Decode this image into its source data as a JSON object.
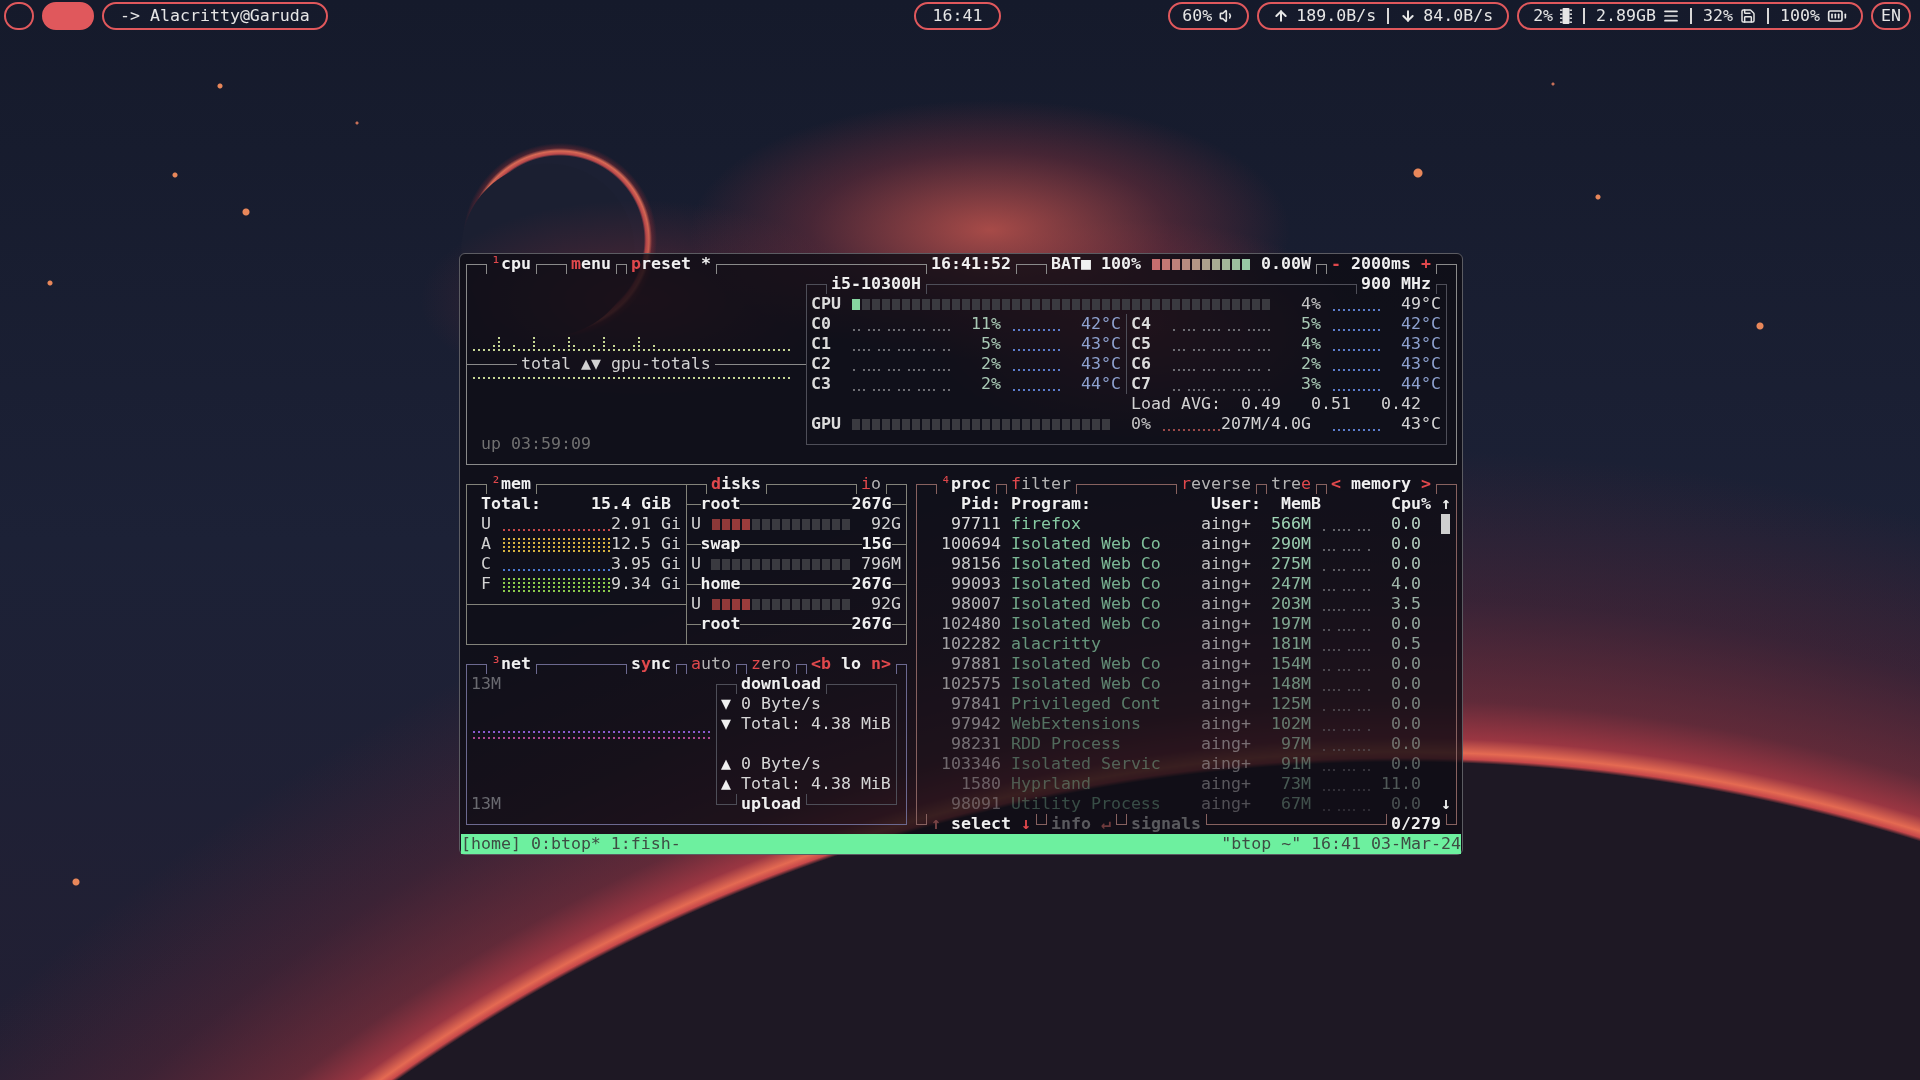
{
  "top_bar": {
    "workspaces": [
      {
        "selected": false
      },
      {
        "selected": true
      }
    ],
    "window_title": "-> Alacritty@Garuda",
    "clock": "16:41",
    "volume": "60%",
    "network": {
      "upload": "189.0B/s",
      "download": "84.0B/s"
    },
    "system": {
      "cpu": "2%",
      "memory": "2.89GB",
      "disk": "32%",
      "battery": "100%"
    },
    "keyboard_layout": "EN"
  },
  "cpu": {
    "number": "¹",
    "title": "cpu",
    "menu": {
      "key": "m",
      "after": "enu"
    },
    "preset": {
      "key": "p",
      "after": "reset *"
    },
    "clock": "16:41:52",
    "battery": {
      "label": "BAT■",
      "percent": "100%",
      "level": 1,
      "power": "0.00W"
    },
    "interval": {
      "decrease": "-",
      "value": "2000ms",
      "increase": "+"
    },
    "graph_label": "total ▲▼ gpu-totals",
    "uptime": "up 03:59:09",
    "model": "i5-10300H",
    "frequency": "900 MHz",
    "total": {
      "label": "CPU",
      "level": 0.03,
      "percent": "4%",
      "temperature": "49°C"
    },
    "cores": [
      {
        "label": "C0",
        "percent": "11%",
        "temperature": "42°C"
      },
      {
        "label": "C1",
        "percent": "5%",
        "temperature": "43°C"
      },
      {
        "label": "C2",
        "percent": "2%",
        "temperature": "43°C"
      },
      {
        "label": "C3",
        "percent": "2%",
        "temperature": "44°C"
      },
      {
        "label": "C4",
        "percent": "5%",
        "temperature": "42°C"
      },
      {
        "label": "C5",
        "percent": "4%",
        "temperature": "43°C"
      },
      {
        "label": "C6",
        "percent": "2%",
        "temperature": "43°C"
      },
      {
        "label": "C7",
        "percent": "3%",
        "temperature": "44°C"
      }
    ],
    "load_avg": {
      "label": "Load AVG:",
      "values": [
        "0.49",
        "0.51",
        "0.42"
      ]
    },
    "gpu": {
      "label": "GPU",
      "level": 0,
      "percent": "0%",
      "memory": "207M/4.0G",
      "temperature": "43°C"
    }
  },
  "mem": {
    "number": "²",
    "title": "mem",
    "total": {
      "label": "Total:",
      "value": "15.4 GiB"
    },
    "stats": [
      {
        "label": "U",
        "value": "2.91 Gi",
        "color": "#c84848",
        "filled": false
      },
      {
        "label": "A",
        "value": "12.5 Gi",
        "color": "#d8b440",
        "filled": true
      },
      {
        "label": "C",
        "value": "3.95 Gi",
        "color": "#4a78d0",
        "filled": false
      },
      {
        "label": "F",
        "value": "9.34 Gi",
        "color": "#8ccc4c",
        "filled": true
      }
    ]
  },
  "disks": {
    "title": {
      "key": "d",
      "after": "isks"
    },
    "io": {
      "key": "i",
      "after": "o",
      "on": false
    },
    "items": [
      {
        "name": "root",
        "size": "267G",
        "used": {
          "label": "U",
          "level": 0.29,
          "value": "92G"
        }
      },
      {
        "name": "swap",
        "size": "15G",
        "used": {
          "label": "U",
          "level": 0,
          "value": "796M"
        }
      },
      {
        "name": "home",
        "size": "267G",
        "used": {
          "label": "U",
          "level": 0.29,
          "value": "92G"
        }
      },
      {
        "name": "root",
        "size": "267G"
      }
    ]
  },
  "net": {
    "number": "³",
    "title": "net",
    "toggles": [
      {
        "before": "s",
        "key": "y",
        "after": "nc",
        "on": true
      },
      {
        "key": "a",
        "after": "uto",
        "on": false
      },
      {
        "key": "z",
        "after": "ero",
        "on": false
      }
    ],
    "interface": {
      "previous": "<b",
      "name": "lo",
      "next": "n>"
    },
    "scale_top": "13M",
    "scale_bottom": "13M",
    "download": {
      "label": "download",
      "lines": [
        {
          "arrow": "▼",
          "text": "0 Byte/s"
        },
        {
          "arrow": "▼",
          "text": "Total: 4.38 MiB"
        }
      ]
    },
    "upload": {
      "label": "upload",
      "lines": [
        {
          "arrow": "▲",
          "text": "0 Byte/s"
        },
        {
          "arrow": "▲",
          "text": "Total: 4.38 MiB"
        }
      ]
    }
  },
  "proc": {
    "number": "⁴",
    "title": "proc",
    "filter": {
      "key": "f",
      "after": "ilter",
      "on": false
    },
    "reverse": {
      "key": "r",
      "after": "everse",
      "on": false
    },
    "tree": {
      "before": "tre",
      "key": "e",
      "on": false
    },
    "sort": {
      "previous": "<",
      "name": "memory",
      "next": ">"
    },
    "columns": [
      "Pid:",
      "Program:",
      "User:",
      "MemB",
      "Cpu%"
    ],
    "rows": [
      {
        "pid": "97711",
        "program": "firefox",
        "user": "aing+",
        "mem": "566M",
        "cpu": "0.0",
        "selected": false
      },
      {
        "pid": "100694",
        "program": "Isolated Web Co",
        "user": "aing+",
        "mem": "290M",
        "cpu": "0.0",
        "selected": false
      },
      {
        "pid": "98156",
        "program": "Isolated Web Co",
        "user": "aing+",
        "mem": "275M",
        "cpu": "0.0",
        "selected": false
      },
      {
        "pid": "99093",
        "program": "Isolated Web Co",
        "user": "aing+",
        "mem": "247M",
        "cpu": "4.0",
        "selected": false
      },
      {
        "pid": "98007",
        "program": "Isolated Web Co",
        "user": "aing+",
        "mem": "203M",
        "cpu": "3.5",
        "selected": false
      },
      {
        "pid": "102480",
        "program": "Isolated Web Co",
        "user": "aing+",
        "mem": "197M",
        "cpu": "0.0",
        "selected": false
      },
      {
        "pid": "102282",
        "program": "alacritty",
        "user": "aing+",
        "mem": "181M",
        "cpu": "0.5",
        "selected": false
      },
      {
        "pid": "97881",
        "program": "Isolated Web Co",
        "user": "aing+",
        "mem": "154M",
        "cpu": "0.0",
        "selected": false
      },
      {
        "pid": "102575",
        "program": "Isolated Web Co",
        "user": "aing+",
        "mem": "148M",
        "cpu": "0.0",
        "selected": false
      },
      {
        "pid": "97841",
        "program": "Privileged Cont",
        "user": "aing+",
        "mem": "125M",
        "cpu": "0.0",
        "selected": false
      },
      {
        "pid": "97942",
        "program": "WebExtensions",
        "user": "aing+",
        "mem": "102M",
        "cpu": "0.0",
        "selected": false
      },
      {
        "pid": "98231",
        "program": "RDD Process",
        "user": "aing+",
        "mem": "97M",
        "cpu": "0.0",
        "selected": false
      },
      {
        "pid": "103346",
        "program": "Isolated Servic",
        "user": "aing+",
        "mem": "91M",
        "cpu": "0.0",
        "selected": false
      },
      {
        "pid": "1580",
        "program": "Hyprland",
        "user": "aing+",
        "mem": "73M",
        "cpu": "11.0",
        "selected": false
      },
      {
        "pid": "98091",
        "program": "Utility Process",
        "user": "aing+",
        "mem": "67M",
        "cpu": "0.0",
        "selected": false
      }
    ],
    "scroll": {
      "up": "↑",
      "down": "↓"
    },
    "footer": {
      "select": {
        "up": "↑",
        "label": "select",
        "down": "↓",
        "disabled": false
      },
      "info": {
        "label": "info",
        "key": "↵",
        "disabled": true
      },
      "signals": {
        "label": "signals",
        "disabled": true
      },
      "count": "0/279"
    }
  },
  "status_bar": {
    "left": "[home] 0:btop* 1:fish-",
    "right": "\"btop ~\" 16:41 03-Mar-24"
  }
}
